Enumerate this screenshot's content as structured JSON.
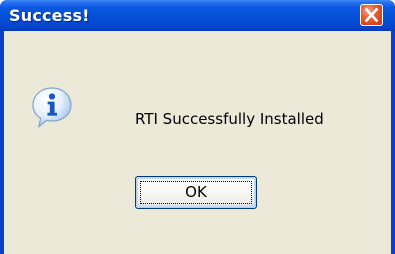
{
  "window": {
    "title": "Success!",
    "close_icon": "close-icon",
    "accent": "#0451d8",
    "client_bg": "#ece9d8"
  },
  "dialog": {
    "icon": "info-icon",
    "message": "RTI Successfully Installed",
    "ok_label": "OK"
  }
}
